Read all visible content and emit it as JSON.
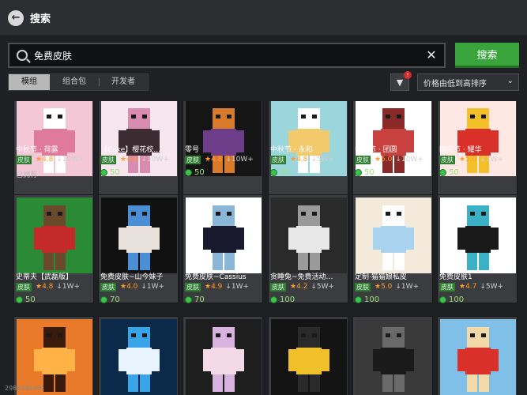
{
  "topbar": {
    "back_icon": "back-arrow-icon",
    "title": "搜索"
  },
  "search": {
    "value": "免费皮肤",
    "button_label": "搜索"
  },
  "tabs": [
    {
      "label": "模组",
      "active": true
    },
    {
      "label": "组合包",
      "active": false
    },
    {
      "label": "开发者",
      "active": false
    }
  ],
  "filter": {
    "badge": "!"
  },
  "sort": {
    "selected": "价格由低到高排序"
  },
  "colors": {
    "accent": "#3aa43c",
    "rating": "#ff9c2a",
    "badge": "#2e7d32"
  },
  "cards": [
    {
      "name": "中秋节 · 荷露",
      "badge": "皮肤",
      "rating": "4.8",
      "downloads": "10W+",
      "footer": "已拥有",
      "palette": [
        "#f4c7d7",
        "#e07a9c",
        "#ffffff"
      ]
    },
    {
      "name": "【Cake】樱花校…",
      "badge": "皮肤",
      "rating": "4.6",
      "downloads": "10W+",
      "price": "50",
      "palette": [
        "#f7e6ee",
        "#3b2a2f",
        "#d98bb0"
      ]
    },
    {
      "name": "零号",
      "badge": "皮肤",
      "rating": "4.8",
      "downloads": "10W+",
      "price": "50",
      "palette": [
        "#151515",
        "#6d3d8a",
        "#d97a2a"
      ]
    },
    {
      "name": "中秋节 · 永和",
      "badge": "皮肤",
      "rating": "4.8",
      "downloads": "5W+",
      "price": "50",
      "palette": [
        "#9bd6dd",
        "#f2c96b",
        "#ffffff"
      ]
    },
    {
      "name": "中秋节 · 团圆",
      "badge": "皮肤",
      "rating": "5.0",
      "downloads": "10W+",
      "price": "50",
      "palette": [
        "#ffffff",
        "#c8413e",
        "#8a2a28"
      ]
    },
    {
      "name": "国庆节 · 耀华",
      "badge": "皮肤",
      "rating": "5.0",
      "downloads": "1W+",
      "price": "50",
      "palette": [
        "#ffe7e4",
        "#d9302a",
        "#f4c02a"
      ]
    },
    {
      "name": "史蒂夫【武磊版】",
      "badge": "皮肤",
      "rating": "4.8",
      "downloads": "1W+",
      "price": "50",
      "palette": [
        "#2b8a35",
        "#c52a2a",
        "#6a4a2a"
      ]
    },
    {
      "name": "免费皮肤~山今妹子",
      "badge": "皮肤",
      "rating": "4.0",
      "downloads": "1W+",
      "price": "70",
      "palette": [
        "#111111",
        "#e9e2dc",
        "#4a8fd6"
      ]
    },
    {
      "name": "免费皮肤~Cassius",
      "badge": "皮肤",
      "rating": "4.9",
      "downloads": "1W+",
      "price": "70",
      "palette": [
        "#ffffff",
        "#1a1a2e",
        "#8ab6d8"
      ]
    },
    {
      "name": "贪睡兔~免费活动…",
      "badge": "皮肤",
      "rating": "4.2",
      "downloads": "5W+",
      "price": "100",
      "palette": [
        "#2a2a2a",
        "#e8e8e8",
        "#9a9a9a"
      ]
    },
    {
      "name": "定制·猫猫娘私皮",
      "badge": "皮肤",
      "rating": "5.0",
      "downloads": "1W+",
      "price": "100",
      "palette": [
        "#f3eadc",
        "#a9d2ee",
        "#ffffff"
      ]
    },
    {
      "name": "免费皮肤1",
      "badge": "皮肤",
      "rating": "4.7",
      "downloads": "5W+",
      "price": "100",
      "palette": [
        "#ffffff",
        "#1a1a1a",
        "#3bb1c5"
      ]
    },
    {
      "palette": [
        "#e87a2a",
        "#ffb347",
        "#3a1a0a"
      ]
    },
    {
      "palette": [
        "#0b2a4a",
        "#e8f4ff",
        "#3aa4e8"
      ]
    },
    {
      "palette": [
        "#1e1e1e",
        "#f4d9e6",
        "#d9b3e0"
      ]
    },
    {
      "palette": [
        "#141414",
        "#f2c02a",
        "#2a2a2a"
      ]
    },
    {
      "palette": [
        "#3a3a3a",
        "#1a1a1a",
        "#6a6a6a"
      ]
    },
    {
      "palette": [
        "#7fbfe8",
        "#d9302a",
        "#f4d9a8"
      ]
    }
  ],
  "footer": {
    "uid": "2986091691"
  }
}
